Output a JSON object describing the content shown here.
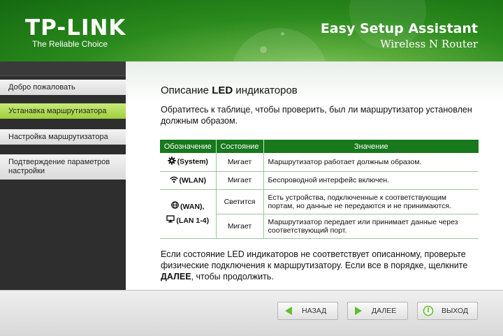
{
  "header": {
    "logo": "TP-LINK",
    "tagline": "The Reliable Choice",
    "app_title": "Easy Setup Assistant",
    "app_subtitle": "Wireless N Router"
  },
  "sidebar": {
    "items": [
      {
        "label": "Добро пожаловать",
        "active": false
      },
      {
        "label": "Устанавка маршрутизатора",
        "active": true
      },
      {
        "label": "Настройка маршрутизатора",
        "active": false
      },
      {
        "label": "Подтверждение параметров настройки",
        "active": false
      }
    ]
  },
  "main": {
    "title_prefix": "Описание ",
    "title_bold": "LED",
    "title_suffix": " индикаторов",
    "intro": "Обратитесь к таблице, чтобы проверить, был ли маршрутизатор установлен должным образом.",
    "table": {
      "headers": [
        "Обозначение",
        "Состояние",
        "Значение"
      ],
      "system": {
        "indicator": "(System)",
        "state": "Мигает",
        "meaning": "Маршрутизатор работает должным образом.",
        "icon": "gear-icon"
      },
      "wlan": {
        "indicator": "(WLAN)",
        "state": "Мигает",
        "meaning": "Беспроводной интерфейс включен.",
        "icon": "wifi-icon"
      },
      "wan_lan": {
        "wan_label": "(WAN),",
        "lan_label": "(LAN 1-4)",
        "wan_icon": "globe-icon",
        "lan_icon": "monitor-icon",
        "rows": [
          {
            "state": "Светится",
            "meaning": "Есть устройства, подключенные к соответствующим портам, но данные не передаются и не принимаются."
          },
          {
            "state": "Мигает",
            "meaning": "Маршрутизатор передает или принимает данные через соответствующий порт."
          }
        ]
      }
    },
    "outro_prefix": "Если состояние LED индикаторов не соответствует описанному, проверьте физические подключения к маршрутизатору. Если все в порядке, щелкните ",
    "outro_bold": "ДАЛЕЕ",
    "outro_suffix": ", чтобы продолжить."
  },
  "footer": {
    "back_label": "НАЗАД",
    "next_label": "ДАЛЕЕ",
    "exit_label": "ВЫХОД"
  },
  "colors": {
    "brand_green": "#17781c",
    "active_nav": "#a8d644",
    "sidebar_bg": "#2e2e2e"
  }
}
